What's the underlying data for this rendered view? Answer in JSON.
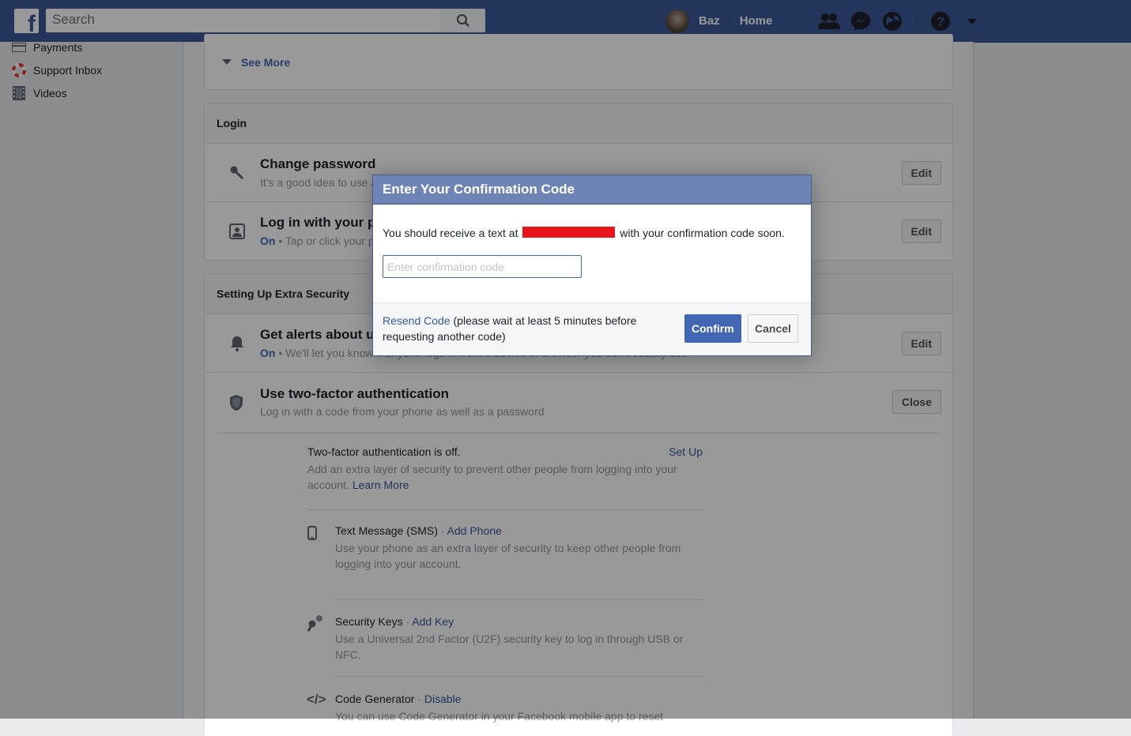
{
  "topbar": {
    "logo": "f",
    "search_placeholder": "Search",
    "user_name": "Baz",
    "home_label": "Home"
  },
  "left_nav": {
    "items": [
      {
        "label": "Payments",
        "icon": "card-icon"
      },
      {
        "label": "Support Inbox",
        "icon": "lifebuoy-icon"
      },
      {
        "label": "Videos",
        "icon": "film-icon"
      }
    ]
  },
  "main": {
    "see_more": "See More",
    "login": {
      "heading": "Login",
      "rows": [
        {
          "title": "Change password",
          "sub": "It's a good idea to use a strong password",
          "button": "Edit"
        },
        {
          "title": "Log in with your profile picture",
          "status": "On",
          "sub": " • Tap or click your profile picture to log in",
          "button": "Edit"
        }
      ]
    },
    "extra_security": {
      "heading": "Setting Up Extra Security",
      "alerts": {
        "title": "Get alerts about unrecognized logins",
        "status": "On",
        "sub": " • We'll let you know if anyone logs in from a device or browser you don't usually use",
        "button": "Edit"
      },
      "tfa": {
        "title": "Use two-factor authentication",
        "sub": "Log in with a code from your phone as well as a password",
        "button": "Close",
        "status_text": "Two-factor authentication is off.",
        "setup_link": "Set Up",
        "description": "Add an extra layer of security to prevent other people from logging into your account.",
        "learn_more": "Learn More",
        "options": [
          {
            "title": "Text Message (SMS)",
            "action": "Add Phone",
            "desc": "Use your phone as an extra layer of security to keep other people from logging into your account."
          },
          {
            "title": "Security Keys",
            "action": "Add Key",
            "desc": "Use a Universal 2nd Factor (U2F) security key to log in through USB or NFC."
          },
          {
            "title": "Code Generator",
            "action": "Disable",
            "desc": "You can use Code Generator in your Facebook mobile app to reset"
          }
        ]
      }
    }
  },
  "modal": {
    "title": "Enter Your Confirmation Code",
    "body_before": "You should receive a text at",
    "body_after": "with your confirmation code soon.",
    "input_placeholder": "Enter confirmation code",
    "resend_link": "Resend Code",
    "resend_note": " (please wait at least 5 minutes before requesting another code)",
    "confirm_label": "Confirm",
    "cancel_label": "Cancel"
  }
}
